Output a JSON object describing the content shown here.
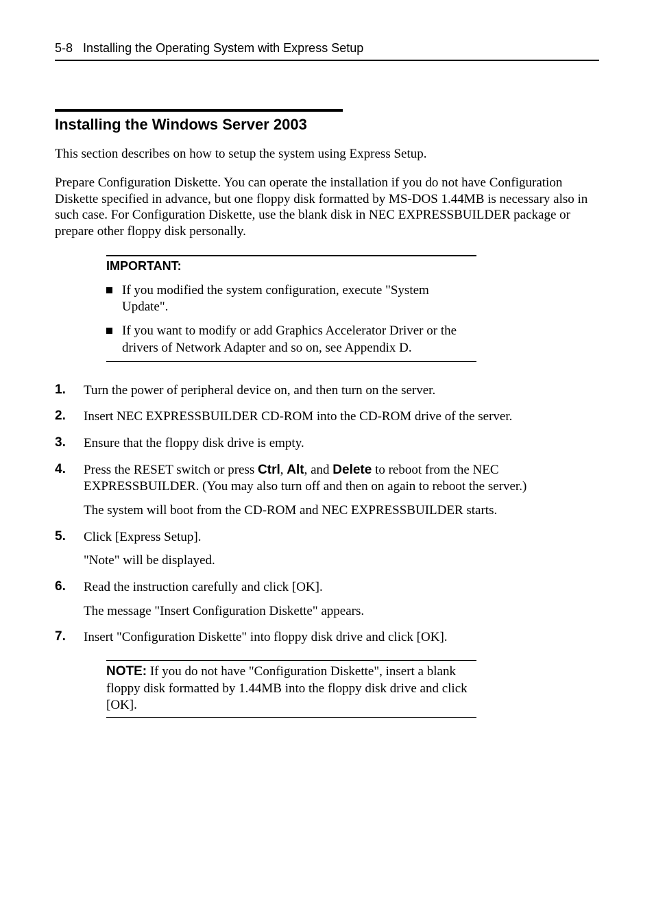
{
  "header": {
    "page_num": "5-8",
    "chapter_title": "Installing the Operating System with Express Setup"
  },
  "section": {
    "title": "Installing the Windows Server 2003",
    "intro1": "This section describes on how to setup the system using Express Setup.",
    "intro2": "Prepare Configuration Diskette.    You can operate the installation if you do not have Configuration Diskette specified in advance, but one floppy disk formatted by MS-DOS 1.44MB is necessary also in such case.    For Configuration Diskette, use the blank disk in NEC EXPRESSBUILDER package or prepare other floppy disk personally."
  },
  "important": {
    "label": "IMPORTANT:",
    "bullets": [
      "If you modified the system configuration, execute \"System Update\".",
      "If you want to modify or add Graphics Accelerator Driver or the drivers of Network Adapter and so on, see Appendix D."
    ]
  },
  "steps": [
    {
      "num": "1.",
      "p1": "Turn the power of peripheral device on, and then turn on the server."
    },
    {
      "num": "2.",
      "p1": "Insert NEC EXPRESSBUILDER CD-ROM into the CD-ROM drive of the server."
    },
    {
      "num": "3.",
      "p1": "Ensure that the floppy disk drive is empty."
    },
    {
      "num": "4.",
      "p1_pre": "Press the RESET switch or press ",
      "k1": "Ctrl",
      "sep1": ", ",
      "k2": "Alt",
      "sep2": ", and ",
      "k3": "Delete",
      "p1_post": " to reboot from the NEC EXPRESSBUILDER.    (You may also turn off and then on again to reboot the server.)",
      "p2": "The system will boot from the CD-ROM and NEC EXPRESSBUILDER starts."
    },
    {
      "num": "5.",
      "p1": "Click [Express Setup].",
      "p2": "\"Note\" will be displayed."
    },
    {
      "num": "6.",
      "p1": "Read the instruction carefully and click [OK].",
      "p2": "The message \"Insert Configuration Diskette\" appears."
    },
    {
      "num": "7.",
      "p1": "Insert \"Configuration Diskette\" into floppy disk drive and click [OK]."
    }
  ],
  "note": {
    "label": "NOTE:",
    "text": " If you do not have \"Configuration Diskette\", insert a blank floppy disk formatted by 1.44MB into the floppy disk drive and click [OK]."
  }
}
